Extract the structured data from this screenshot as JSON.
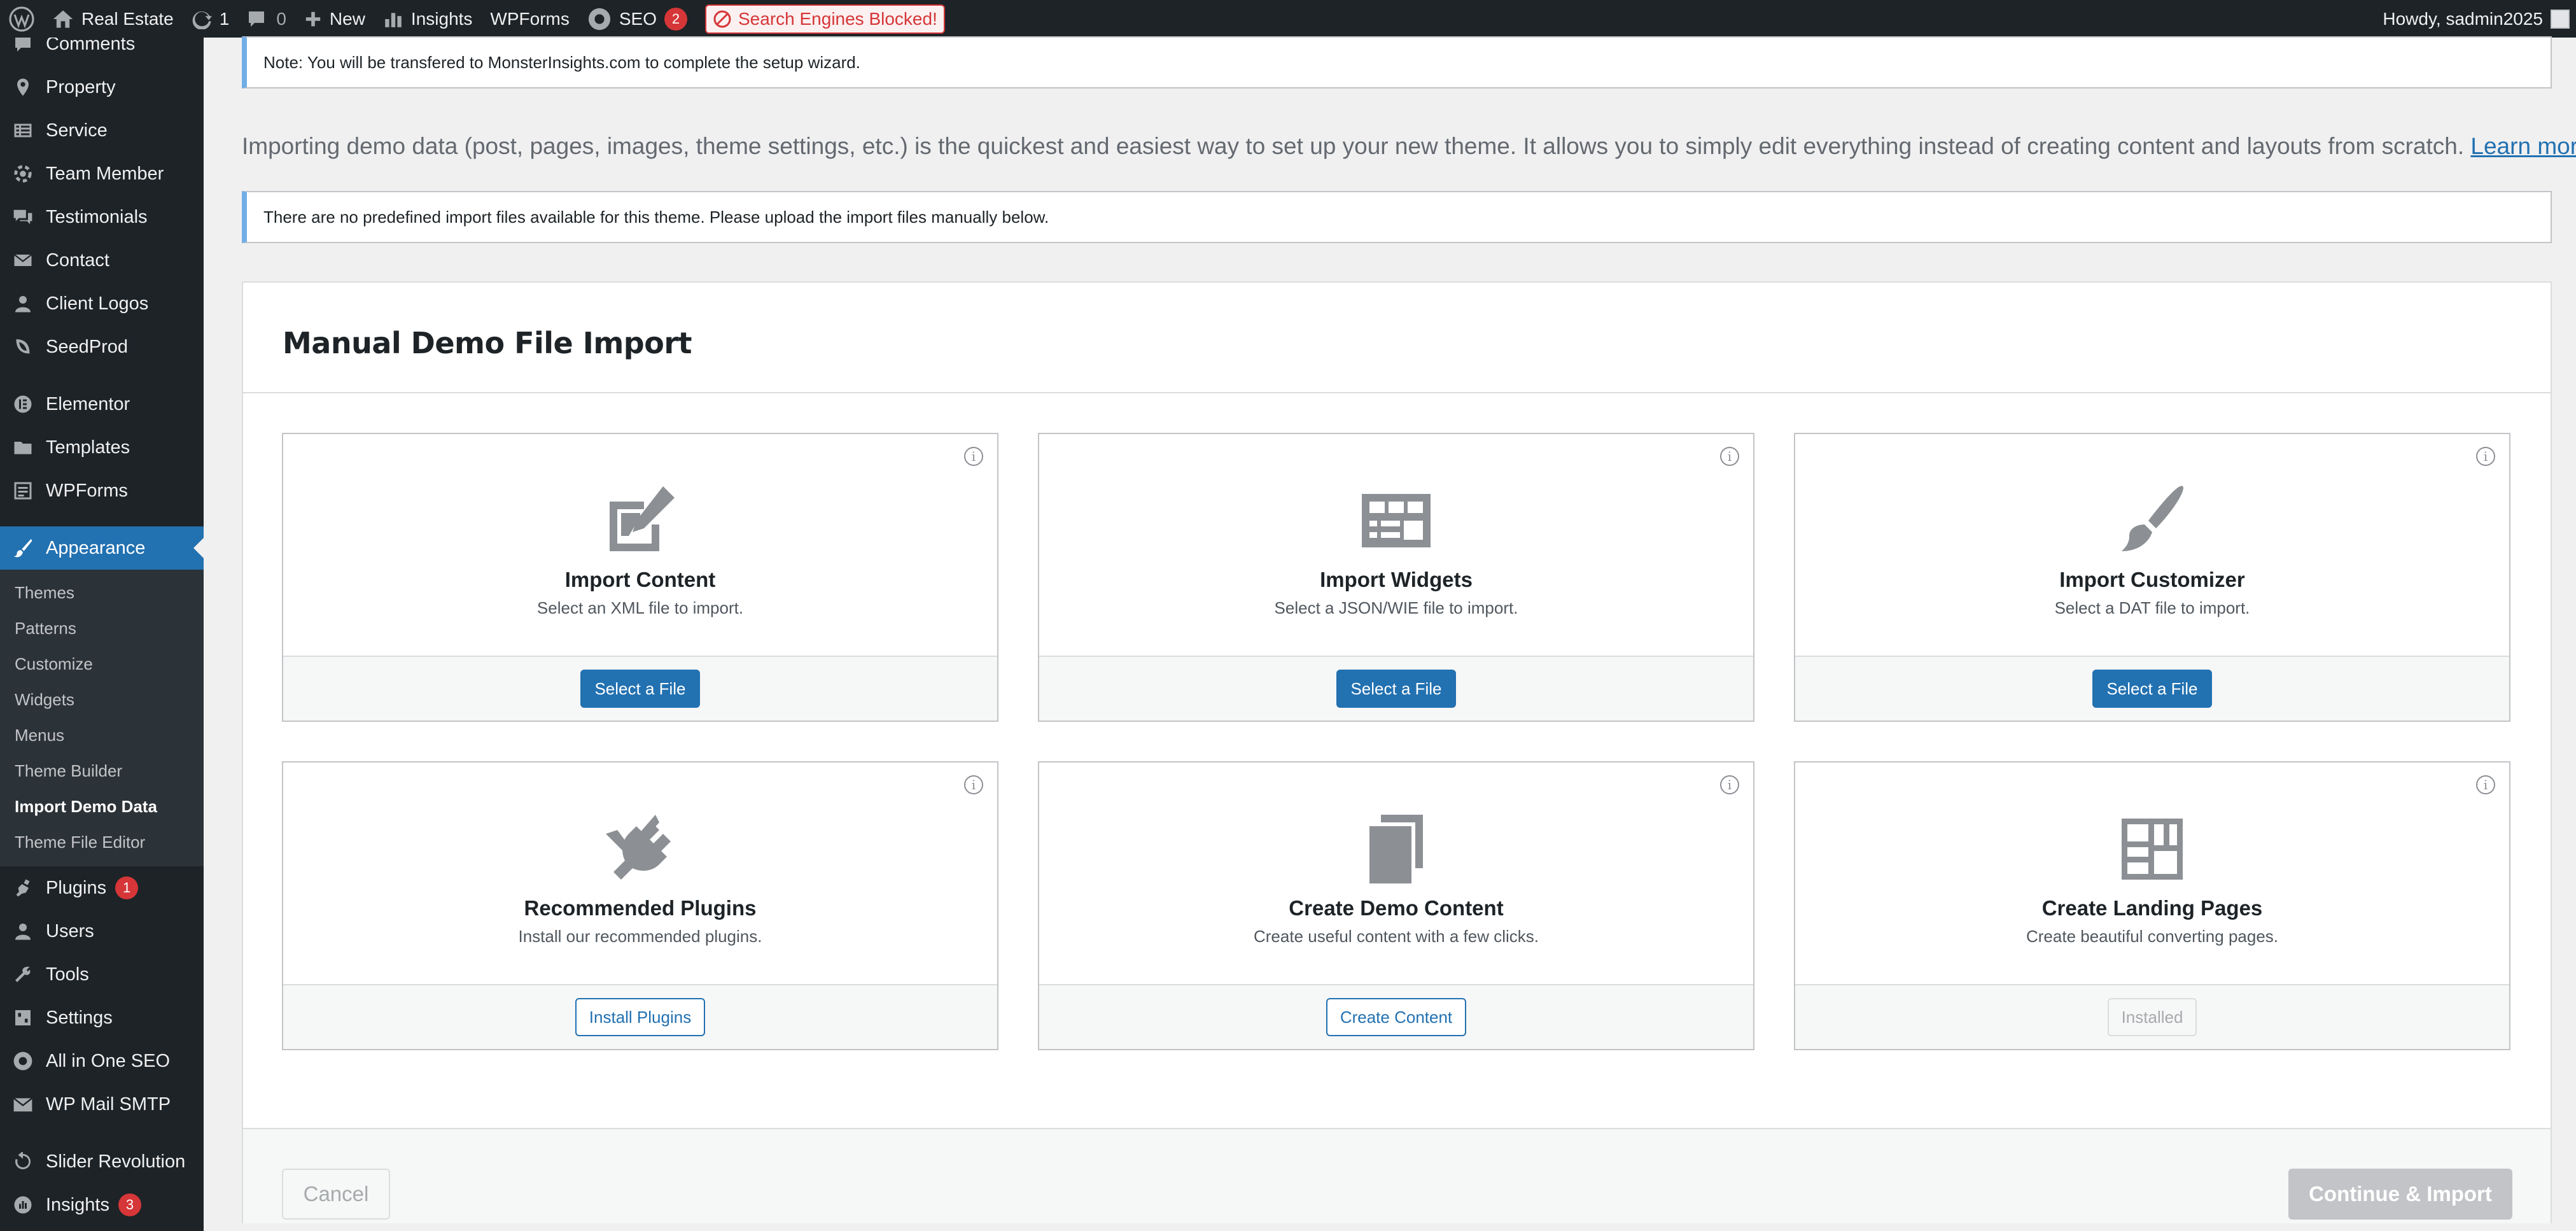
{
  "adminbar": {
    "site_name": "Real Estate",
    "updates_count": "1",
    "comments_count": "0",
    "new_label": "New",
    "insights_label": "Insights",
    "wpforms_label": "WPForms",
    "seo_label": "SEO",
    "seo_badge": "2",
    "blocked_label": "Search Engines Blocked!",
    "howdy": "Howdy, sadmin2025"
  },
  "sidebar": {
    "items_top": [
      {
        "label": "Comments",
        "icon": "comments-icon"
      },
      {
        "label": "Property",
        "icon": "location-pin-icon"
      },
      {
        "label": "Service",
        "icon": "service-list-icon"
      },
      {
        "label": "Team Member",
        "icon": "team-icon"
      },
      {
        "label": "Testimonials",
        "icon": "testimonials-icon"
      },
      {
        "label": "Contact",
        "icon": "envelope-icon"
      },
      {
        "label": "Client Logos",
        "icon": "user-icon"
      },
      {
        "label": "SeedProd",
        "icon": "seedprod-icon"
      }
    ],
    "items_mid": [
      {
        "label": "Elementor",
        "icon": "elementor-icon"
      },
      {
        "label": "Templates",
        "icon": "folder-icon"
      },
      {
        "label": "WPForms",
        "icon": "wpforms-icon"
      }
    ],
    "appearance": {
      "label": "Appearance",
      "icon": "paintbrush-icon"
    },
    "submenu": [
      {
        "label": "Themes",
        "current": false
      },
      {
        "label": "Patterns",
        "current": false
      },
      {
        "label": "Customize",
        "current": false
      },
      {
        "label": "Widgets",
        "current": false
      },
      {
        "label": "Menus",
        "current": false
      },
      {
        "label": "Theme Builder",
        "current": false
      },
      {
        "label": "Import Demo Data",
        "current": true
      },
      {
        "label": "Theme File Editor",
        "current": false
      }
    ],
    "items_bottom": [
      {
        "label": "Plugins",
        "icon": "plugins-icon",
        "badge": "1"
      },
      {
        "label": "Users",
        "icon": "users-icon"
      },
      {
        "label": "Tools",
        "icon": "wrench-icon"
      },
      {
        "label": "Settings",
        "icon": "settings-icon"
      },
      {
        "label": "All in One SEO",
        "icon": "aioseo-icon"
      },
      {
        "label": "WP Mail SMTP",
        "icon": "mail-smtp-icon"
      }
    ],
    "items_last": [
      {
        "label": "Slider Revolution",
        "icon": "slider-revolution-icon"
      },
      {
        "label": "Insights",
        "icon": "insights-icon",
        "badge": "3"
      }
    ]
  },
  "main": {
    "notice_top": "Note: You will be transfered to MonsterInsights.com to complete the setup wizard.",
    "intro_text": "Importing demo data (post, pages, images, theme settings, etc.) is the quickest and easiest way to set up your new theme. It allows you to simply edit everything instead of creating content and layouts from scratch.",
    "learn_more": "Learn more",
    "intro_period": ".",
    "notice_import": "There are no predefined import files available for this theme. Please upload the import files manually below.",
    "panel_title": "Manual Demo File Import",
    "cards": [
      {
        "title": "Import Content",
        "desc": "Select an XML file to import.",
        "button": "Select a File",
        "icon": "edit-page-icon"
      },
      {
        "title": "Import Widgets",
        "desc": "Select a JSON/WIE file to import.",
        "button": "Select a File",
        "icon": "widgets-icon"
      },
      {
        "title": "Import Customizer",
        "desc": "Select a DAT file to import.",
        "button": "Select a File",
        "icon": "brush-icon"
      },
      {
        "title": "Recommended Plugins",
        "desc": "Install our recommended plugins.",
        "button": "Install Plugins",
        "icon": "plugin-check-icon"
      },
      {
        "title": "Create Demo Content",
        "desc": "Create useful content with a few clicks.",
        "button": "Create Content",
        "icon": "pages-icon"
      },
      {
        "title": "Create Landing Pages",
        "desc": "Create beautiful converting pages.",
        "button": "Installed",
        "icon": "layout-icon"
      }
    ],
    "info_glyph": "i",
    "cancel": "Cancel",
    "continue": "Continue & Import"
  }
}
